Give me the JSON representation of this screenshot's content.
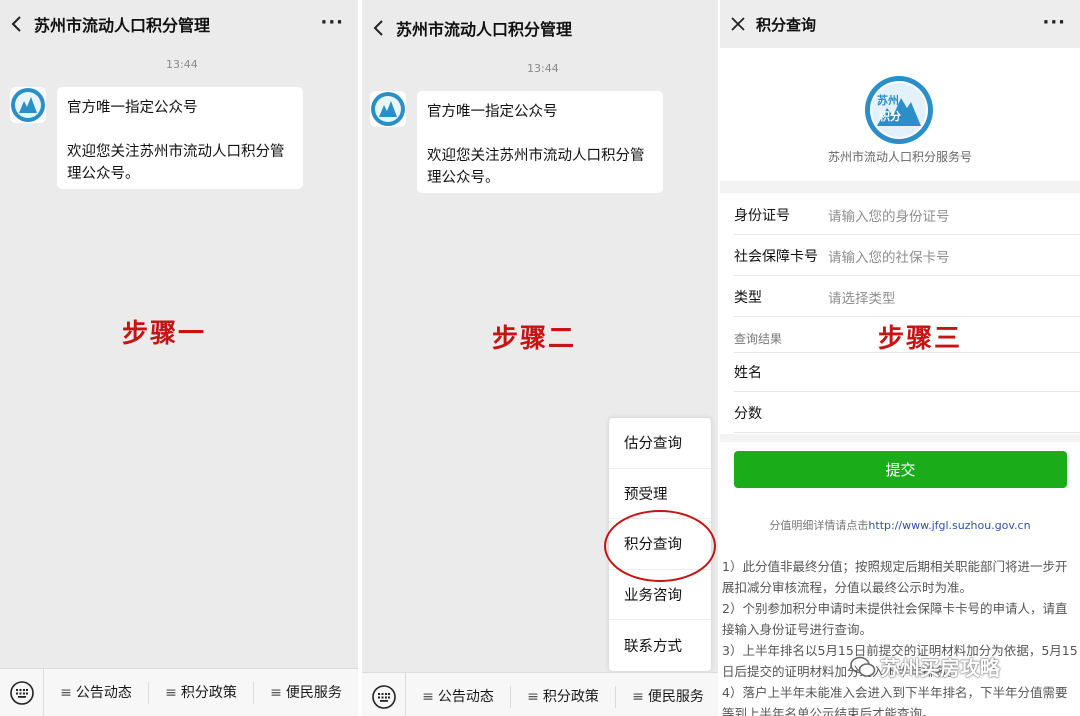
{
  "account_title": "苏州市流动人口积分管理",
  "more_glyph": "···",
  "chat": {
    "time": "13:44",
    "message_line1": "官方唯一指定公众号",
    "message_line2": "欢迎您关注苏州市流动人口积分管理公众号。",
    "message_line2_wrap_a": "欢迎您关注苏州市流动人口积分管",
    "message_line2_wrap_b": "理公众号。",
    "message_line2_wrap2_a": "欢迎您关注苏州市流动人口积分管",
    "message_line2_wrap2_b": "理公众号。"
  },
  "steps": {
    "one": "步骤一",
    "two": "步骤二",
    "three": "步骤三"
  },
  "bottom_menu": {
    "items": [
      {
        "icon": "menu-lines-icon",
        "label": "公告动态"
      },
      {
        "icon": "menu-lines-icon",
        "label": "积分政策"
      },
      {
        "icon": "menu-lines-icon",
        "label": "便民服务"
      }
    ],
    "hamburger": "≡"
  },
  "popup_menu": {
    "items": [
      "估分查询",
      "预受理",
      "积分查询",
      "业务咨询",
      "联系方式"
    ],
    "highlighted": "积分查询"
  },
  "query_page": {
    "title": "积分查询",
    "logo_text_top": "苏州",
    "logo_text_bottom": "积分",
    "service_name": "苏州市流动人口积分服务号",
    "fields": [
      {
        "label": "身份证号",
        "placeholder": "请输入您的身份证号"
      },
      {
        "label": "社会保障卡号",
        "placeholder": "请输入您的社保卡号"
      },
      {
        "label": "类型",
        "placeholder": "请选择类型"
      }
    ],
    "result_label": "查询结果",
    "result_fields": [
      "姓名",
      "分数"
    ],
    "submit_label": "提交",
    "detail_prefix": "分值明细详情请点击",
    "detail_link": "http://www.jfgl.suzhou.gov.cn",
    "notes": [
      "1）此分值非最终分值；按照规定后期相关职能部门将进一步开展扣减分审核流程，分值以最终公示时为准。",
      "2）个别参加积分申请时未提供社会保障卡卡号的申请人，请直接输入身份证号进行查询。",
      "3）上半年排名以5月15日前提交的证明材料加分为依据，5月15日后提交的证明材料加分纳入下半年排名。",
      "4）落户上半年未能准入会进入到下半年排名，下半年分值需要等到上半年名单公示结束后才能查询。"
    ]
  },
  "watermark": "苏州买房攻略",
  "colors": {
    "accent_red": "#c41414",
    "wechat_green": "#1aad19",
    "link_blue": "#2e52a8"
  }
}
